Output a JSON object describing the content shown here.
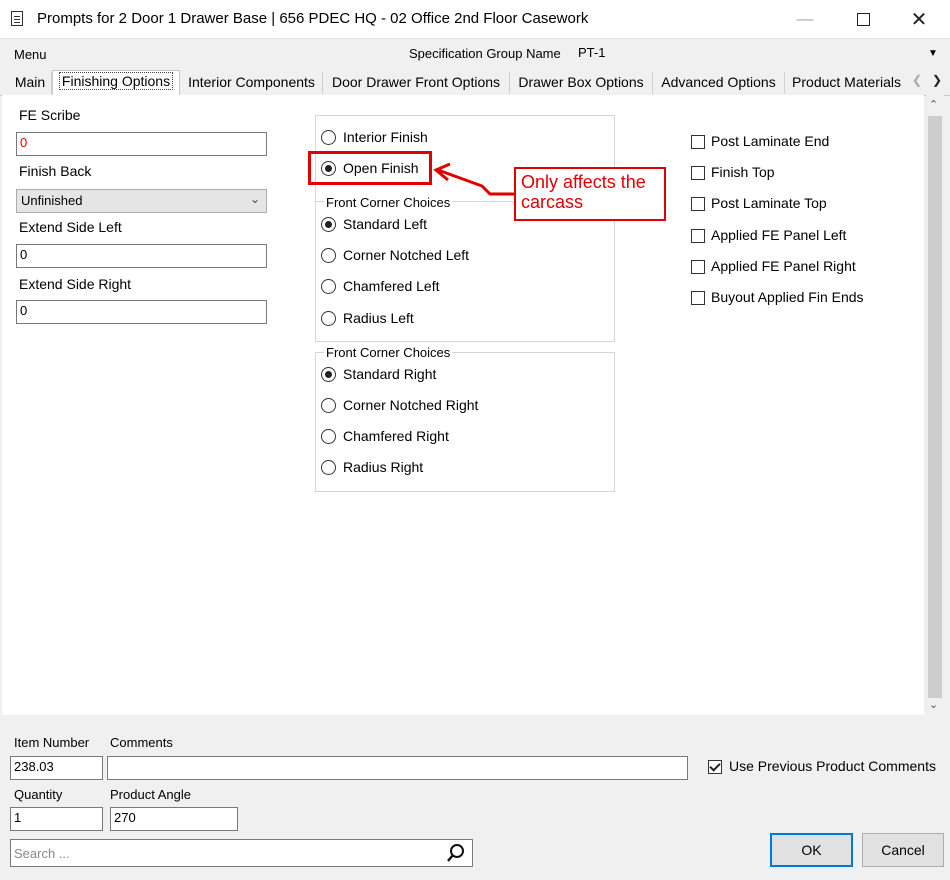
{
  "window": {
    "title": "Prompts for 2 Door 1 Drawer Base | 656 PDEC HQ - 02 Office 2nd Floor Casework",
    "min_icon": "minimize-icon",
    "max_icon": "maximize-icon",
    "close_icon": "close-icon"
  },
  "menubar": {
    "menu_label": "Menu",
    "spec_group_label": "Specification Group Name",
    "spec_group_value": "PT-1"
  },
  "tabs": [
    {
      "label": "Main"
    },
    {
      "label": "Finishing Options",
      "active": true
    },
    {
      "label": "Interior Components"
    },
    {
      "label": "Door Drawer Front Options"
    },
    {
      "label": "Drawer Box Options"
    },
    {
      "label": "Advanced Options"
    },
    {
      "label": "Product Materials"
    }
  ],
  "left": {
    "fe_scribe_label": "FE Scribe",
    "fe_scribe_value": "0",
    "finish_back_label": "Finish Back",
    "finish_back_value": "Unfinished",
    "extend_left_label": "Extend Side Left",
    "extend_left_value": "0",
    "extend_right_label": "Extend Side Right",
    "extend_right_value": "0"
  },
  "finish": {
    "options": [
      {
        "label": "Interior Finish",
        "selected": false
      },
      {
        "label": "Open Finish",
        "selected": true
      }
    ]
  },
  "corner_left": {
    "legend": "Front Corner Choices",
    "options": [
      {
        "label": "Standard Left",
        "selected": true
      },
      {
        "label": "Corner Notched Left",
        "selected": false
      },
      {
        "label": "Chamfered Left",
        "selected": false
      },
      {
        "label": "Radius Left",
        "selected": false
      }
    ]
  },
  "corner_right": {
    "legend": "Front Corner Choices",
    "options": [
      {
        "label": "Standard Right",
        "selected": true
      },
      {
        "label": "Corner Notched Right",
        "selected": false
      },
      {
        "label": "Chamfered Right",
        "selected": false
      },
      {
        "label": "Radius Right",
        "selected": false
      }
    ]
  },
  "callout": {
    "text_line1": "Only affects the",
    "text_line2": "carcass",
    "color": "#e00000"
  },
  "checkboxes": [
    {
      "label": "Post Laminate End",
      "checked": false
    },
    {
      "label": "Finish Top",
      "checked": false
    },
    {
      "label": "Post Laminate Top",
      "checked": false
    },
    {
      "label": "Applied FE Panel Left",
      "checked": false
    },
    {
      "label": "Applied FE Panel Right",
      "checked": false
    },
    {
      "label": "Buyout Applied Fin Ends",
      "checked": false
    }
  ],
  "bottom": {
    "item_number_label": "Item Number",
    "item_number_value": "238.03",
    "comments_label": "Comments",
    "comments_value": "",
    "use_prev_label": "Use Previous Product Comments",
    "use_prev_checked": true,
    "quantity_label": "Quantity",
    "quantity_value": "1",
    "angle_label": "Product Angle",
    "angle_value": "270",
    "search_placeholder": "Search ...",
    "search_icon": "search-icon",
    "ok_label": "OK",
    "cancel_label": "Cancel"
  }
}
